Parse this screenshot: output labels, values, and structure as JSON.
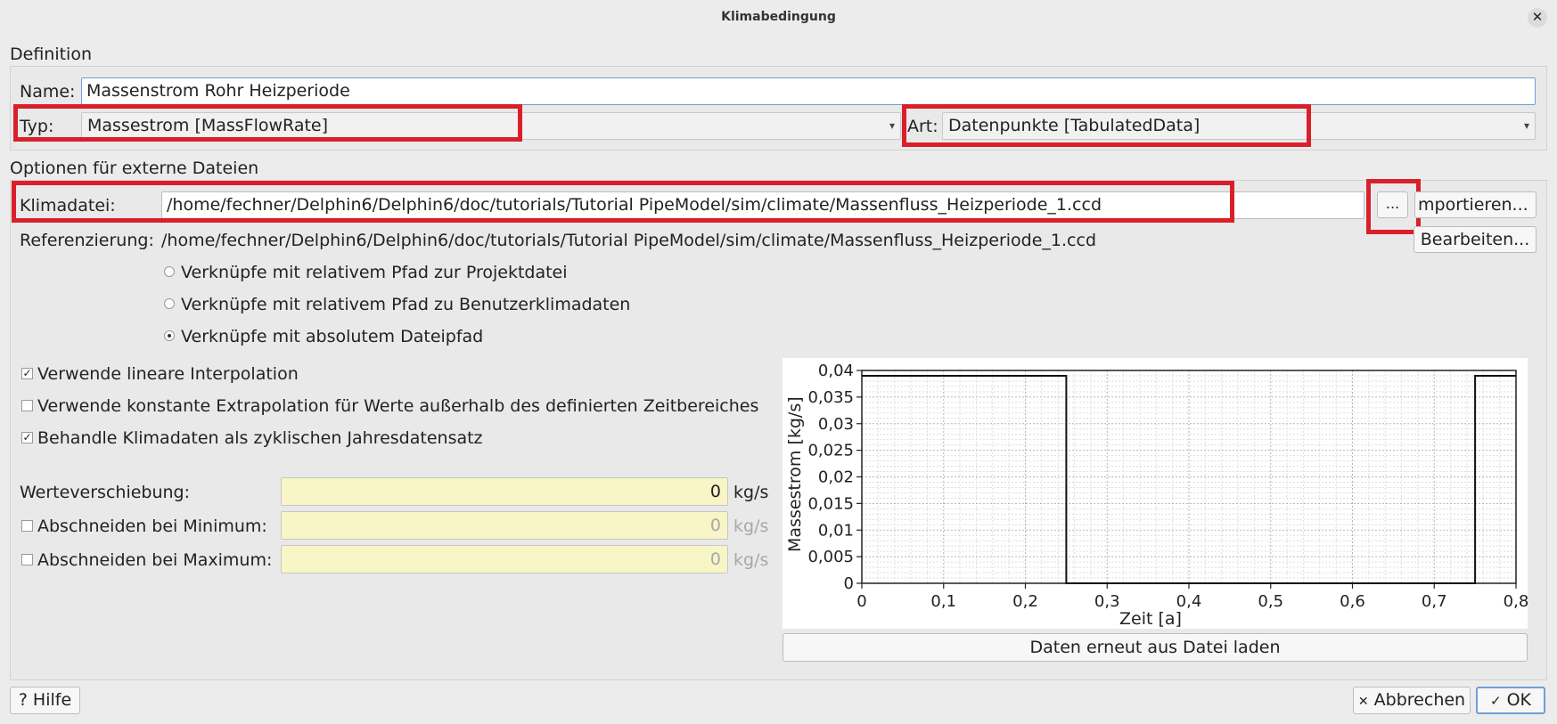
{
  "window": {
    "title": "Klimabedingung",
    "close_icon": "close-icon"
  },
  "definition": {
    "group_title": "Definition",
    "name_label": "Name:",
    "name_value": "Massenstrom Rohr Heizperiode",
    "typ_label": "Typ:",
    "typ_value": "Massestrom [MassFlowRate]",
    "art_label": "Art:",
    "art_value": "Datenpunkte [TabulatedData]"
  },
  "external": {
    "group_title": "Optionen für externe Dateien",
    "klimadatei_label": "Klimadatei:",
    "klimadatei_value": "/home/fechner/Delphin6/Delphin6/doc/tutorials/Tutorial PipeModel/sim/climate/Massenfluss_Heizperiode_1.ccd",
    "browse_label": "...",
    "import_label": "mportieren...",
    "referenz_label": "Referenzierung:",
    "referenz_value": "/home/fechner/Delphin6/Delphin6/doc/tutorials/Tutorial PipeModel/sim/climate/Massenfluss_Heizperiode_1.ccd",
    "edit_label": "Bearbeiten...",
    "radios": [
      {
        "label": "Verknüpfe mit relativem Pfad zur Projektdatei",
        "checked": false
      },
      {
        "label": "Verknüpfe mit relativem Pfad zu Benutzerklimadaten",
        "checked": false
      },
      {
        "label": "Verknüpfe mit absolutem Dateipfad",
        "checked": true
      }
    ],
    "checkboxes": [
      {
        "label": "Verwende lineare Interpolation",
        "checked": true
      },
      {
        "label": "Verwende konstante Extrapolation für Werte außerhalb des definierten Zeitbereiches",
        "checked": false
      },
      {
        "label": "Behandle Klimadaten als zyklischen Jahresdatensatz",
        "checked": true
      }
    ],
    "shift_label": "Werteverschiebung:",
    "shift_value": "0",
    "shift_unit": "kg/s",
    "min_label": "Abschneiden bei Minimum:",
    "min_value": "0",
    "min_unit": "kg/s",
    "max_label": "Abschneiden bei Maximum:",
    "max_value": "0",
    "max_unit": "kg/s",
    "reload_label": "Daten erneut aus Datei laden"
  },
  "footer": {
    "help_label": "? Hilfe",
    "cancel_label": "Abbrechen",
    "ok_label": "OK"
  },
  "chart_data": {
    "type": "line",
    "xlabel": "Zeit [a]",
    "ylabel": "Massestrom [kg/s]",
    "xlim": [
      0,
      0.8
    ],
    "ylim": [
      0,
      0.04
    ],
    "x_ticks": [
      "0",
      "0,1",
      "0,2",
      "0,3",
      "0,4",
      "0,5",
      "0,6",
      "0,7",
      "0,8"
    ],
    "y_ticks": [
      "0",
      "0,005",
      "0,01",
      "0,015",
      "0,02",
      "0,025",
      "0,03",
      "0,035",
      "0,04"
    ],
    "grid": true,
    "series": [
      {
        "x": [
          0,
          0.25,
          0.25,
          0.75,
          0.75,
          0.8
        ],
        "y": [
          0.039,
          0.039,
          0,
          0,
          0.039,
          0.039
        ]
      }
    ]
  }
}
